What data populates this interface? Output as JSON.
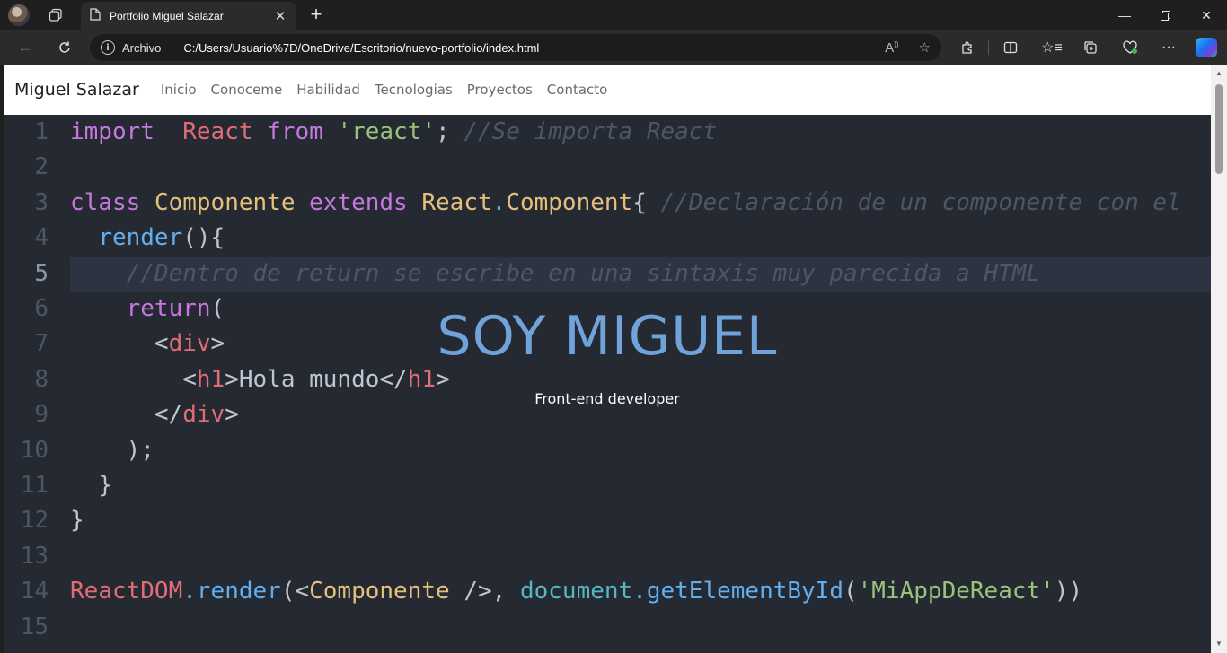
{
  "browser": {
    "tab_title": "Portfolio Miguel Salazar",
    "address_label": "Archivo",
    "url": "C:/Users/Usuario%7D/OneDrive/Escritorio/nuevo-portfolio/index.html"
  },
  "navbar": {
    "brand": "Miguel Salazar",
    "links": [
      "Inicio",
      "Conoceme",
      "Habilidad",
      "Tecnologias",
      "Proyectos",
      "Contacto"
    ]
  },
  "hero": {
    "title": "SOY MIGUEL",
    "subtitle": "Front-end developer"
  },
  "code_background": {
    "line_numbers": [
      "1",
      "2",
      "3",
      "4",
      "5",
      "6",
      "7",
      "8",
      "9",
      "10",
      "11",
      "12",
      "13",
      "14",
      "15"
    ],
    "active_line": 5,
    "lines": [
      [
        [
          "kw",
          "import"
        ],
        [
          "",
          "  "
        ],
        [
          "red",
          "React"
        ],
        [
          "",
          ""
        ],
        [
          "kw",
          " from"
        ],
        [
          "",
          " "
        ],
        [
          "str",
          "'react'"
        ],
        [
          "",
          ";"
        ],
        [
          "cm",
          " //Se importa React"
        ]
      ],
      [],
      [
        [
          "kw",
          "class"
        ],
        [
          "",
          " "
        ],
        [
          "cls",
          "Componente"
        ],
        [
          "",
          " "
        ],
        [
          "kw",
          "extends"
        ],
        [
          "",
          " "
        ],
        [
          "cls",
          "React"
        ],
        [
          "cy",
          "."
        ],
        [
          "cls",
          "Component"
        ],
        [
          "",
          "{ "
        ],
        [
          "cm",
          "//Declaración de un componente con el"
        ]
      ],
      [
        [
          "",
          "  "
        ],
        [
          "fn",
          "render"
        ],
        [
          "",
          "(){"
        ]
      ],
      [
        [
          "",
          "    "
        ],
        [
          "cm",
          "//Dentro de return se escribe en una sintaxis muy parecida a HTML"
        ]
      ],
      [
        [
          "",
          "    "
        ],
        [
          "kw",
          "return"
        ],
        [
          "",
          "("
        ]
      ],
      [
        [
          "",
          "      <"
        ],
        [
          "red",
          "div"
        ],
        [
          "",
          ">"
        ]
      ],
      [
        [
          "",
          "        <"
        ],
        [
          "red",
          "h1"
        ],
        [
          "",
          ">Hola mundo</"
        ],
        [
          "red",
          "h1"
        ],
        [
          "",
          ">"
        ]
      ],
      [
        [
          "",
          "      </"
        ],
        [
          "red",
          "div"
        ],
        [
          "",
          ">"
        ]
      ],
      [
        [
          "",
          "    );"
        ]
      ],
      [
        [
          "",
          "  }"
        ]
      ],
      [
        [
          "",
          "}"
        ]
      ],
      [],
      [
        [
          "red",
          "ReactDOM"
        ],
        [
          "cy",
          "."
        ],
        [
          "fn",
          "render"
        ],
        [
          "",
          "(<"
        ],
        [
          "cls",
          "Componente"
        ],
        [
          "",
          " />, "
        ],
        [
          "cy",
          "document"
        ],
        [
          "cy",
          "."
        ],
        [
          "fn",
          "getElementById"
        ],
        [
          "",
          "("
        ],
        [
          "str",
          "'MiAppDeReact'"
        ],
        [
          "",
          "))"
        ]
      ],
      []
    ]
  }
}
